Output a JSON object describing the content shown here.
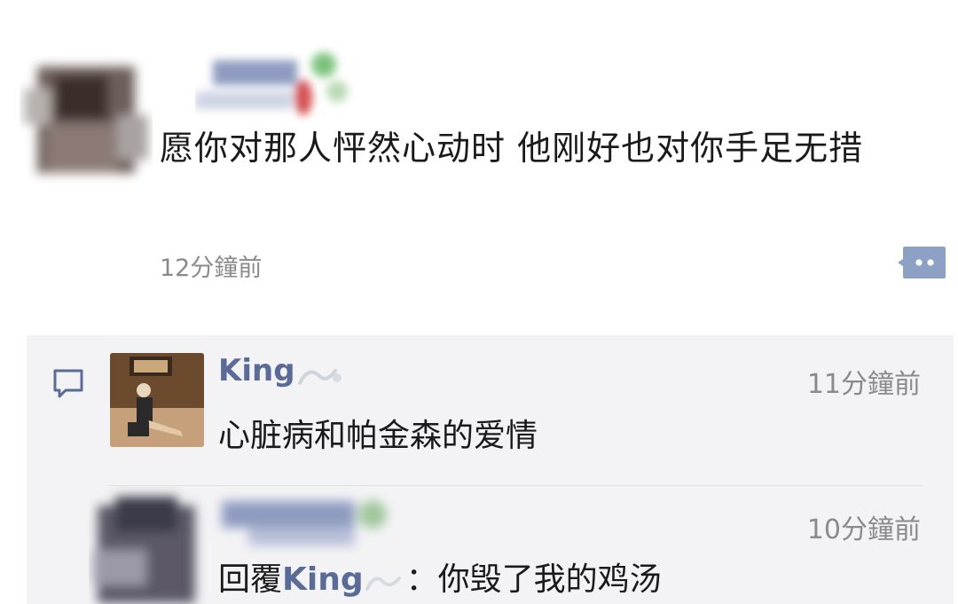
{
  "post": {
    "text": "愿你对那人怦然心动时 他刚好也对你手足无措",
    "time": "12分鐘前",
    "more_icon": "more-dots-icon"
  },
  "comments": [
    {
      "name": "King",
      "time": "11分鐘前",
      "text": "心脏病和帕金森的爱情"
    },
    {
      "time": "10分鐘前",
      "reply_prefix": "回覆",
      "reply_to": "King",
      "separator": "：",
      "text": "你毁了我的鸡汤"
    }
  ],
  "colors": {
    "name_link": "#5a6b97",
    "time_text": "#8a8a8a",
    "comment_bg": "#f3f3f5"
  }
}
